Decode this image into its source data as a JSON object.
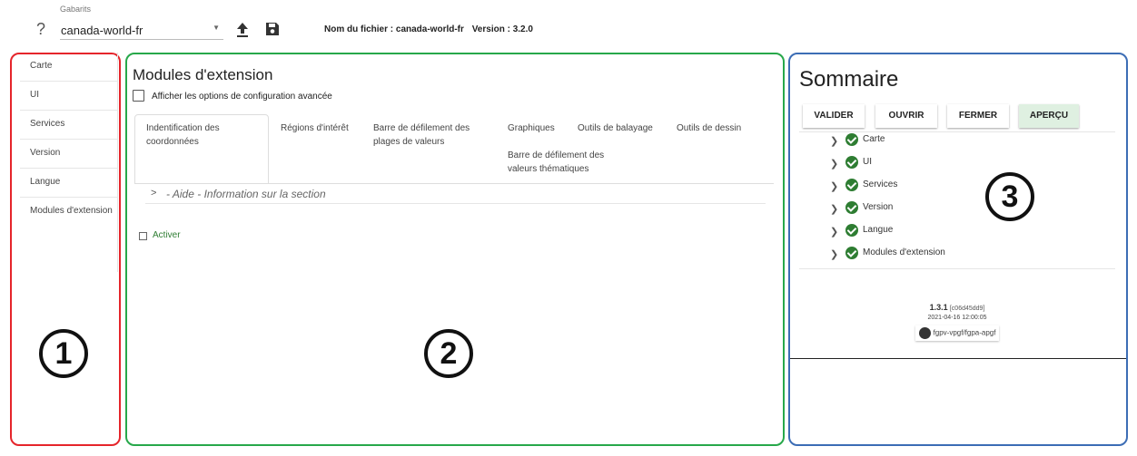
{
  "header": {
    "help_icon": "?",
    "gabarits_label": "Gabarits",
    "template_value": "canada-world-fr",
    "file_name_label": "Nom du fichier : canada-world-fr",
    "version_label": "Version : 3.2.0"
  },
  "sidebar": {
    "items": [
      {
        "label": "Carte"
      },
      {
        "label": "UI"
      },
      {
        "label": "Services"
      },
      {
        "label": "Version"
      },
      {
        "label": "Langue"
      },
      {
        "label": "Modules d'extension"
      }
    ]
  },
  "main": {
    "title": "Modules d'extension",
    "advanced_option_label": "Afficher les options de configuration avancée",
    "tabs": [
      {
        "label": "Indentification des coordonnées"
      },
      {
        "label": "Régions d'intérêt"
      },
      {
        "label": "Barre de défilement des plages de valeurs"
      },
      {
        "label": "Graphiques"
      },
      {
        "label": "Outils de balayage"
      },
      {
        "label": "Outils de dessin"
      },
      {
        "label": "Barre de défilement des valeurs thématiques"
      }
    ],
    "help_chevron": ">",
    "help_text": "- Aide - Information sur la section",
    "activate_label": "Activer"
  },
  "summary": {
    "title": "Sommaire",
    "buttons": [
      {
        "label": "VALIDER"
      },
      {
        "label": "OUVRIR"
      },
      {
        "label": "FERMER"
      },
      {
        "label": "APERÇU"
      }
    ],
    "items": [
      {
        "label": "Carte"
      },
      {
        "label": "UI"
      },
      {
        "label": "Services"
      },
      {
        "label": "Version"
      },
      {
        "label": "Langue"
      },
      {
        "label": "Modules d'extension"
      }
    ],
    "version": "1.3.1",
    "hash": "[c06d45dd9]",
    "date": "2021-04-16 12:00:05",
    "repo": "fgpv-vpgf/fgpa-apgf"
  },
  "annotations": {
    "one": "1",
    "two": "2",
    "three": "3"
  },
  "colors": {
    "frame_left": "#e5252b",
    "frame_middle": "#27a84a",
    "frame_right": "#3c6db5",
    "check_green": "#2e7d32",
    "preview_button": "#dff0e1"
  },
  "icons": {
    "help": "question-mark-icon",
    "upload": "upload-icon",
    "save": "floppy-disk-icon",
    "chevron": "chevron-right-icon",
    "check": "check-circle-icon",
    "github": "github-icon"
  }
}
